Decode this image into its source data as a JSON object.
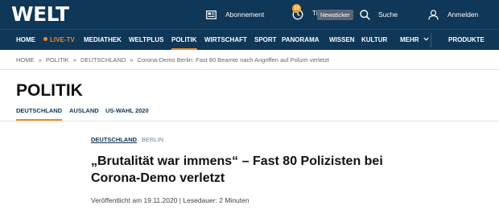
{
  "header": {
    "logo": "WELT",
    "abonnement": "Abonnement",
    "newsticker_badge": "10",
    "newsticker_label": "Ti",
    "newsticker_tooltip": "Newsticker",
    "search": "Suche",
    "login": "Anmelden"
  },
  "nav": {
    "home": "HOME",
    "live": "LIVE-TV",
    "mediathek": "MEDIATHEK",
    "weltplus": "WELTPLUS",
    "politik": "POLITIK",
    "wirtschaft": "WIRTSCHAFT",
    "sport": "SPORT",
    "panorama": "PANORAMA",
    "wissen": "WISSEN",
    "kultur": "KULTUR",
    "mehr": "MEHR",
    "produkte": "PRODUKTE"
  },
  "breadcrumb": {
    "items": [
      "HOME",
      "POLITIK",
      "DEUTSCHLAND",
      "Corona-Demo Berlin: Fast 80 Beamte nach Angriffen auf Polizei verletzt"
    ],
    "separator": "»"
  },
  "section": {
    "title": "POLITIK",
    "subnav": [
      "DEUTSCHLAND",
      "AUSLAND",
      "US-WAHL 2020"
    ]
  },
  "article": {
    "topics": [
      "DEUTSCHLAND",
      "BERLIN"
    ],
    "headline": "„Brutalität war immens“ – Fast 80 Polizisten bei Corona-Demo verletzt",
    "meta": "Veröffentlicht am 19.11.2020 | Lesedauer: 2 Minuten"
  },
  "colors": {
    "header_bg": "#0f3758",
    "accent": "#e8892b",
    "badge": "#f0a22c"
  },
  "icons": [
    "newspaper-icon",
    "clock-icon",
    "search-icon",
    "user-icon",
    "chevron-down-icon"
  ]
}
